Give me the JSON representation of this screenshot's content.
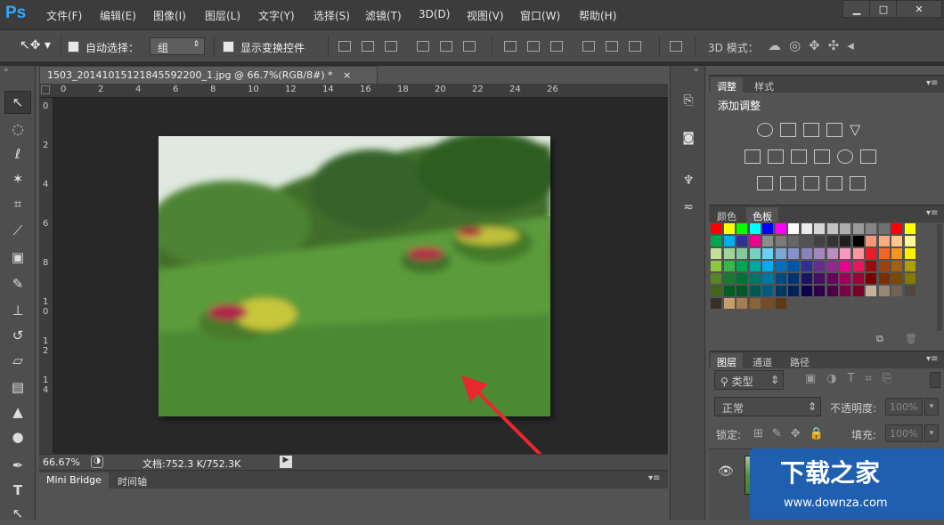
{
  "app": {
    "logo": "Ps"
  },
  "menu": [
    "文件(F)",
    "编辑(E)",
    "图像(I)",
    "图层(L)",
    "文字(Y)",
    "选择(S)",
    "滤镜(T)",
    "3D(D)",
    "视图(V)",
    "窗口(W)",
    "帮助(H)"
  ],
  "options": {
    "auto_select_label": "自动选择：",
    "auto_select_value": "组",
    "show_transform_label": "显示变换控件",
    "mode3d_label": "3D 模式："
  },
  "document": {
    "tab_title": "1503_20141015121845592200_1.jpg @ 66.7%(RGB/8#) *",
    "close": "×",
    "ruler_h": [
      "0",
      "2",
      "4",
      "6",
      "8",
      "10",
      "12",
      "14",
      "16",
      "18",
      "20",
      "22",
      "24",
      "26"
    ],
    "ruler_v": [
      "0",
      "2",
      "4",
      "6",
      "8",
      "1\n0",
      "1\n2",
      "1\n4"
    ],
    "zoom": "66.67%",
    "doc_size": "文档:752.3 K/752.3K"
  },
  "bottom_tabs": [
    "Mini Bridge",
    "时间轴"
  ],
  "panels": {
    "adjust_tabs": [
      "调整",
      "样式"
    ],
    "adjust_title": "添加调整",
    "color_tabs": [
      "颜色",
      "色板"
    ],
    "layer_tabs": [
      "图层",
      "通道",
      "路径"
    ],
    "filter_kind": "类型",
    "blend_mode": "正常",
    "opacity_label": "不透明度:",
    "opacity_value": "100%",
    "lock_label": "锁定:",
    "fill_label": "填充:",
    "fill_value": "100%"
  },
  "watermark": {
    "title": "下载之家",
    "url": "www.downza.com"
  },
  "swatch_rows": [
    [
      "#ff0000",
      "#ffff00",
      "#00ff00",
      "#00ffff",
      "#0000ff",
      "#ff00ff",
      "#ffffff",
      "#ebebeb",
      "#d6d6d6",
      "#c2c2c2",
      "#adadad",
      "#999999",
      "#858585",
      "#707070",
      "#ff0000",
      "#ffff00"
    ],
    [
      "#00a651",
      "#00aeef",
      "#2e3192",
      "#ec008c",
      "#8c8c8c",
      "#7a7a7a",
      "#666666",
      "#525252",
      "#424242",
      "#333333",
      "#1f1f1f",
      "#000000",
      "#f7977a",
      "#fbad82",
      "#fdc68a",
      "#fff79a"
    ],
    [
      "#c4df9b",
      "#a3d39c",
      "#82ca9d",
      "#7bcdc8",
      "#6ecff6",
      "#7ea7d8",
      "#8493ca",
      "#8882be",
      "#a187be",
      "#bc8dbf",
      "#f49ac2",
      "#f6989d",
      "#ed1c24",
      "#f26522",
      "#f7941d",
      "#fff200"
    ],
    [
      "#8dc73f",
      "#39b54a",
      "#00a651",
      "#00a99d",
      "#00aeef",
      "#0072bc",
      "#0054a6",
      "#2e3192",
      "#662d91",
      "#92278f",
      "#ec008c",
      "#ed145b",
      "#9e0b0f",
      "#a0410d",
      "#a36209",
      "#aba000"
    ],
    [
      "#598527",
      "#197b30",
      "#007236",
      "#00746b",
      "#0076a3",
      "#004a80",
      "#003471",
      "#1b1464",
      "#440e62",
      "#630460",
      "#9e005d",
      "#9e0039",
      "#790000",
      "#7b2e00",
      "#7d4900",
      "#827b00"
    ],
    [
      "#406618",
      "#005e20",
      "#005826",
      "#005952",
      "#005b7f",
      "#003663",
      "#002157",
      "#0d004c",
      "#32004b",
      "#4b0049",
      "#7b0046",
      "#7a0026",
      "#c7b299",
      "#998675",
      "#736357",
      "#534741"
    ],
    [
      "#37302a",
      "#c69c6d",
      "#a67c52",
      "#8c6239",
      "#754c24",
      "#603913"
    ]
  ],
  "colors": {
    "accent": "#31a8ff",
    "bg_panel": "#535353",
    "bg_dark": "#282828",
    "arrow": "#e8282c",
    "watermark_bg": "#1f5fb0"
  }
}
